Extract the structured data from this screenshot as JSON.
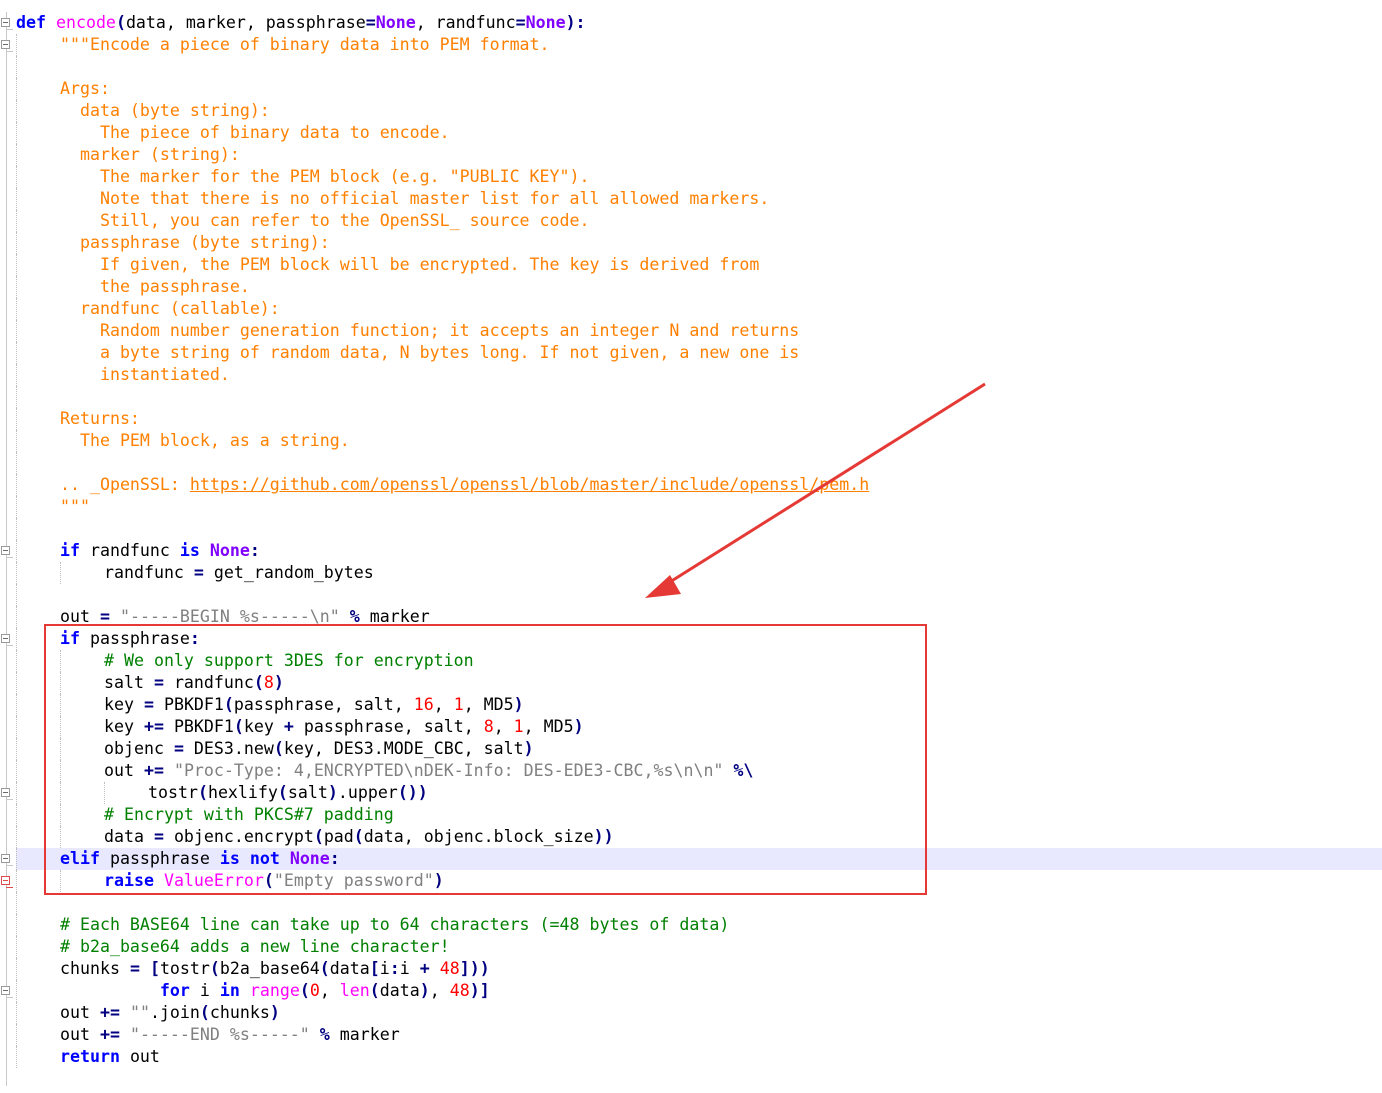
{
  "editor": {
    "language": "Python",
    "colors": {
      "keyword": "#0000ff",
      "function_name": "#ff00ff",
      "none_constant": "#8000ff",
      "operator": "#000080",
      "number": "#ff0000",
      "docstring": "#ff8000",
      "comment": "#008000",
      "string": "#808080",
      "current_line": "#e8e8ff",
      "annotation": "#e53935"
    },
    "fold_markers": [
      {
        "line": 1,
        "state": "expanded"
      },
      {
        "line": 2,
        "state": "expanded"
      },
      {
        "line": 25,
        "state": "expanded"
      },
      {
        "line": 29,
        "state": "expanded"
      },
      {
        "line": 36,
        "state": "expanded"
      },
      {
        "line": 39,
        "state": "expanded"
      },
      {
        "line": 40,
        "state": "error"
      },
      {
        "line": 45,
        "state": "expanded"
      }
    ],
    "lines": [
      {
        "indent": 0,
        "tokens": [
          {
            "t": "def",
            "c": "kw"
          },
          {
            "t": " "
          },
          {
            "t": "encode",
            "c": "fn"
          },
          {
            "t": "(",
            "c": "pn"
          },
          {
            "t": "data, marker, passphrase"
          },
          {
            "t": "=",
            "c": "op"
          },
          {
            "t": "None",
            "c": "none"
          },
          {
            "t": ", randfunc"
          },
          {
            "t": "=",
            "c": "op"
          },
          {
            "t": "None",
            "c": "none"
          },
          {
            "t": "):",
            "c": "pn"
          }
        ]
      },
      {
        "indent": 1,
        "tokens": [
          {
            "t": "\"\"\"Encode a piece of binary data into PEM format.",
            "c": "doc"
          }
        ]
      },
      {
        "indent": 1,
        "tokens": []
      },
      {
        "indent": 1,
        "tokens": [
          {
            "t": "Args:",
            "c": "doc"
          }
        ]
      },
      {
        "indent": 1,
        "tokens": [
          {
            "t": "  data (byte string):",
            "c": "doc"
          }
        ]
      },
      {
        "indent": 1,
        "tokens": [
          {
            "t": "    The piece of binary data to encode.",
            "c": "doc"
          }
        ]
      },
      {
        "indent": 1,
        "tokens": [
          {
            "t": "  marker (string):",
            "c": "doc"
          }
        ]
      },
      {
        "indent": 1,
        "tokens": [
          {
            "t": "    The marker for the PEM block (e.g. \"PUBLIC KEY\").",
            "c": "doc"
          }
        ]
      },
      {
        "indent": 1,
        "tokens": [
          {
            "t": "    Note that there is no official master list for all allowed markers.",
            "c": "doc"
          }
        ]
      },
      {
        "indent": 1,
        "tokens": [
          {
            "t": "    Still, you can refer to the OpenSSL_ source code.",
            "c": "doc"
          }
        ]
      },
      {
        "indent": 1,
        "tokens": [
          {
            "t": "  passphrase (byte string):",
            "c": "doc"
          }
        ]
      },
      {
        "indent": 1,
        "tokens": [
          {
            "t": "    If given, the PEM block will be encrypted. The key is derived from",
            "c": "doc"
          }
        ]
      },
      {
        "indent": 1,
        "tokens": [
          {
            "t": "    the passphrase.",
            "c": "doc"
          }
        ]
      },
      {
        "indent": 1,
        "tokens": [
          {
            "t": "  randfunc (callable):",
            "c": "doc"
          }
        ]
      },
      {
        "indent": 1,
        "tokens": [
          {
            "t": "    Random number generation function; it accepts an integer N and returns",
            "c": "doc"
          }
        ]
      },
      {
        "indent": 1,
        "tokens": [
          {
            "t": "    a byte string of random data, N bytes long. If not given, a new one is",
            "c": "doc"
          }
        ]
      },
      {
        "indent": 1,
        "tokens": [
          {
            "t": "    instantiated.",
            "c": "doc"
          }
        ]
      },
      {
        "indent": 1,
        "tokens": []
      },
      {
        "indent": 1,
        "tokens": [
          {
            "t": "Returns:",
            "c": "doc"
          }
        ]
      },
      {
        "indent": 1,
        "tokens": [
          {
            "t": "  The PEM block, as a string.",
            "c": "doc"
          }
        ]
      },
      {
        "indent": 1,
        "tokens": []
      },
      {
        "indent": 1,
        "tokens": [
          {
            "t": ".. _OpenSSL: ",
            "c": "doc"
          },
          {
            "t": "https://github.com/openssl/openssl/blob/master/include/openssl/pem.h",
            "c": "url"
          }
        ]
      },
      {
        "indent": 1,
        "tokens": [
          {
            "t": "\"\"\"",
            "c": "doc"
          }
        ]
      },
      {
        "indent": 1,
        "tokens": []
      },
      {
        "indent": 1,
        "tokens": [
          {
            "t": "if",
            "c": "kw"
          },
          {
            "t": " randfunc "
          },
          {
            "t": "is",
            "c": "kw"
          },
          {
            "t": " "
          },
          {
            "t": "None",
            "c": "none"
          },
          {
            "t": ":",
            "c": "pn"
          }
        ]
      },
      {
        "indent": 2,
        "tokens": [
          {
            "t": "randfunc "
          },
          {
            "t": "=",
            "c": "op"
          },
          {
            "t": " get_random_bytes"
          }
        ]
      },
      {
        "indent": 1,
        "tokens": []
      },
      {
        "indent": 1,
        "tokens": [
          {
            "t": "out "
          },
          {
            "t": "=",
            "c": "op"
          },
          {
            "t": " "
          },
          {
            "t": "\"-----BEGIN %s-----\\n\"",
            "c": "str"
          },
          {
            "t": " "
          },
          {
            "t": "%",
            "c": "op"
          },
          {
            "t": " marker"
          }
        ]
      },
      {
        "indent": 1,
        "tokens": [
          {
            "t": "if",
            "c": "kw"
          },
          {
            "t": " passphrase"
          },
          {
            "t": ":",
            "c": "pn"
          }
        ]
      },
      {
        "indent": 2,
        "tokens": [
          {
            "t": "# We only support 3DES for encryption",
            "c": "cm"
          }
        ]
      },
      {
        "indent": 2,
        "tokens": [
          {
            "t": "salt "
          },
          {
            "t": "=",
            "c": "op"
          },
          {
            "t": " randfunc"
          },
          {
            "t": "(",
            "c": "pn"
          },
          {
            "t": "8",
            "c": "num"
          },
          {
            "t": ")",
            "c": "pn"
          }
        ]
      },
      {
        "indent": 2,
        "tokens": [
          {
            "t": "key "
          },
          {
            "t": "=",
            "c": "op"
          },
          {
            "t": " PBKDF1"
          },
          {
            "t": "(",
            "c": "pn"
          },
          {
            "t": "passphrase, salt, "
          },
          {
            "t": "16",
            "c": "num"
          },
          {
            "t": ", "
          },
          {
            "t": "1",
            "c": "num"
          },
          {
            "t": ", MD5"
          },
          {
            "t": ")",
            "c": "pn"
          }
        ]
      },
      {
        "indent": 2,
        "tokens": [
          {
            "t": "key "
          },
          {
            "t": "+=",
            "c": "op"
          },
          {
            "t": " PBKDF1"
          },
          {
            "t": "(",
            "c": "pn"
          },
          {
            "t": "key "
          },
          {
            "t": "+",
            "c": "op"
          },
          {
            "t": " passphrase, salt, "
          },
          {
            "t": "8",
            "c": "num"
          },
          {
            "t": ", "
          },
          {
            "t": "1",
            "c": "num"
          },
          {
            "t": ", MD5"
          },
          {
            "t": ")",
            "c": "pn"
          }
        ]
      },
      {
        "indent": 2,
        "tokens": [
          {
            "t": "objenc "
          },
          {
            "t": "=",
            "c": "op"
          },
          {
            "t": " DES3.new"
          },
          {
            "t": "(",
            "c": "pn"
          },
          {
            "t": "key, DES3.MODE_CBC, salt"
          },
          {
            "t": ")",
            "c": "pn"
          }
        ]
      },
      {
        "indent": 2,
        "tokens": [
          {
            "t": "out "
          },
          {
            "t": "+=",
            "c": "op"
          },
          {
            "t": " "
          },
          {
            "t": "\"Proc-Type: 4,ENCRYPTED\\nDEK-Info: DES-EDE3-CBC,%s\\n\\n\"",
            "c": "str"
          },
          {
            "t": " "
          },
          {
            "t": "%\\",
            "c": "op"
          }
        ]
      },
      {
        "indent": 3,
        "tokens": [
          {
            "t": "tostr"
          },
          {
            "t": "(",
            "c": "pn"
          },
          {
            "t": "hexlify"
          },
          {
            "t": "(",
            "c": "pn"
          },
          {
            "t": "salt"
          },
          {
            "t": ")",
            "c": "pn"
          },
          {
            "t": ".upper"
          },
          {
            "t": "())",
            "c": "pn"
          }
        ]
      },
      {
        "indent": 2,
        "tokens": [
          {
            "t": "# Encrypt with PKCS#7 padding",
            "c": "cm"
          }
        ]
      },
      {
        "indent": 2,
        "tokens": [
          {
            "t": "data "
          },
          {
            "t": "=",
            "c": "op"
          },
          {
            "t": " objenc.encrypt"
          },
          {
            "t": "(",
            "c": "pn"
          },
          {
            "t": "pad"
          },
          {
            "t": "(",
            "c": "pn"
          },
          {
            "t": "data, objenc.block_size"
          },
          {
            "t": "))",
            "c": "pn"
          }
        ]
      },
      {
        "indent": 1,
        "hl": true,
        "tokens": [
          {
            "t": "elif",
            "c": "kw"
          },
          {
            "t": " passphrase "
          },
          {
            "t": "is",
            "c": "kw"
          },
          {
            "t": " "
          },
          {
            "t": "not",
            "c": "kw"
          },
          {
            "t": " "
          },
          {
            "t": "None",
            "c": "none"
          },
          {
            "t": ":",
            "c": "pn"
          }
        ]
      },
      {
        "indent": 2,
        "tokens": [
          {
            "t": "raise",
            "c": "kw"
          },
          {
            "t": " "
          },
          {
            "t": "ValueError",
            "c": "fn"
          },
          {
            "t": "(",
            "c": "pn"
          },
          {
            "t": "\"Empty password\"",
            "c": "str"
          },
          {
            "t": ")",
            "c": "pn"
          }
        ]
      },
      {
        "indent": 1,
        "tokens": []
      },
      {
        "indent": 1,
        "tokens": [
          {
            "t": "# Each BASE64 line can take up to 64 characters (=48 bytes of data)",
            "c": "cm"
          }
        ]
      },
      {
        "indent": 1,
        "tokens": [
          {
            "t": "# b2a_base64 adds a new line character!",
            "c": "cm"
          }
        ]
      },
      {
        "indent": 1,
        "tokens": [
          {
            "t": "chunks "
          },
          {
            "t": "=",
            "c": "op"
          },
          {
            "t": " "
          },
          {
            "t": "[",
            "c": "pn"
          },
          {
            "t": "tostr"
          },
          {
            "t": "(",
            "c": "pn"
          },
          {
            "t": "b2a_base64"
          },
          {
            "t": "(",
            "c": "pn"
          },
          {
            "t": "data"
          },
          {
            "t": "[",
            "c": "pn"
          },
          {
            "t": "i"
          },
          {
            "t": ":",
            "c": "pn"
          },
          {
            "t": "i "
          },
          {
            "t": "+",
            "c": "op"
          },
          {
            "t": " "
          },
          {
            "t": "48",
            "c": "num"
          },
          {
            "t": "]))",
            "c": "pn"
          }
        ]
      },
      {
        "indent": 1,
        "tokens": [
          {
            "t": "          "
          },
          {
            "t": "for",
            "c": "kw"
          },
          {
            "t": " i "
          },
          {
            "t": "in",
            "c": "kw"
          },
          {
            "t": " "
          },
          {
            "t": "range",
            "c": "fn"
          },
          {
            "t": "(",
            "c": "pn"
          },
          {
            "t": "0",
            "c": "num"
          },
          {
            "t": ", "
          },
          {
            "t": "len",
            "c": "fn"
          },
          {
            "t": "(",
            "c": "pn"
          },
          {
            "t": "data"
          },
          {
            "t": ")",
            "c": "pn"
          },
          {
            "t": ", "
          },
          {
            "t": "48",
            "c": "num"
          },
          {
            "t": ")]",
            "c": "pn"
          }
        ]
      },
      {
        "indent": 1,
        "tokens": [
          {
            "t": "out "
          },
          {
            "t": "+=",
            "c": "op"
          },
          {
            "t": " "
          },
          {
            "t": "\"\"",
            "c": "str"
          },
          {
            "t": ".join"
          },
          {
            "t": "(",
            "c": "pn"
          },
          {
            "t": "chunks"
          },
          {
            "t": ")",
            "c": "pn"
          }
        ]
      },
      {
        "indent": 1,
        "tokens": [
          {
            "t": "out "
          },
          {
            "t": "+=",
            "c": "op"
          },
          {
            "t": " "
          },
          {
            "t": "\"-----END %s-----\"",
            "c": "str"
          },
          {
            "t": " "
          },
          {
            "t": "%",
            "c": "op"
          },
          {
            "t": " marker"
          }
        ]
      },
      {
        "indent": 1,
        "tokens": [
          {
            "t": "return",
            "c": "kw"
          },
          {
            "t": " out"
          }
        ]
      }
    ]
  }
}
